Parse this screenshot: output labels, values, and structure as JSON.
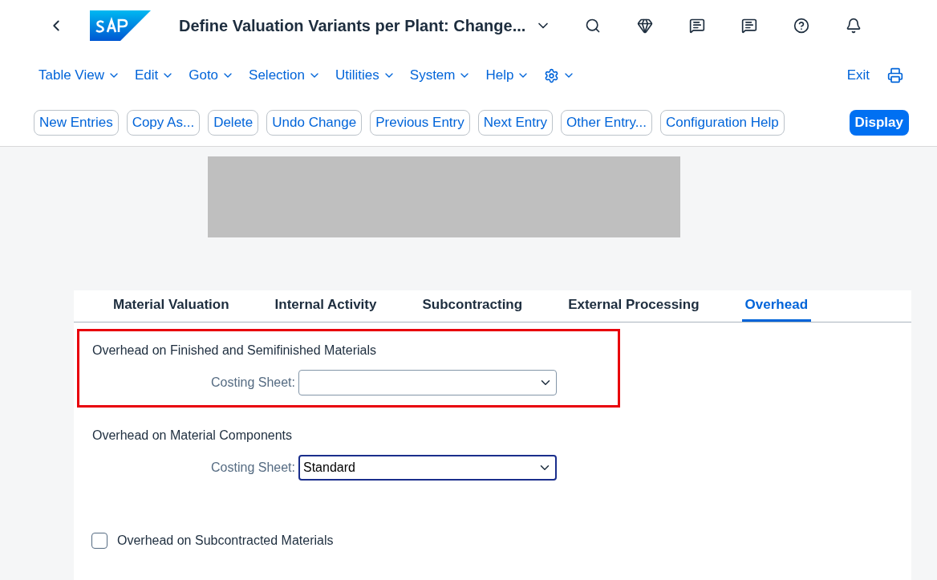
{
  "header": {
    "title": "Define Valuation Variants per Plant: Change..."
  },
  "menus": [
    {
      "label": "Table View"
    },
    {
      "label": "Edit"
    },
    {
      "label": "Goto"
    },
    {
      "label": "Selection"
    },
    {
      "label": "Utilities"
    },
    {
      "label": "System"
    },
    {
      "label": "Help"
    }
  ],
  "exit_label": "Exit",
  "toolbar_buttons": [
    {
      "label": "New Entries",
      "kind": "outline"
    },
    {
      "label": "Copy As...",
      "kind": "outline"
    },
    {
      "label": "Delete",
      "kind": "outline"
    },
    {
      "label": "Undo Change",
      "kind": "outline"
    },
    {
      "label": "Previous Entry",
      "kind": "outline"
    },
    {
      "label": "Next Entry",
      "kind": "outline"
    },
    {
      "label": "Other Entry...",
      "kind": "outline"
    },
    {
      "label": "Configuration Help",
      "kind": "outline"
    },
    {
      "label": "Display",
      "kind": "primary"
    }
  ],
  "tabs": [
    {
      "label": "Material Valuation",
      "selected": false
    },
    {
      "label": "Internal Activity",
      "selected": false
    },
    {
      "label": "Subcontracting",
      "selected": false
    },
    {
      "label": "External Processing",
      "selected": false
    },
    {
      "label": "Overhead",
      "selected": true
    }
  ],
  "sections": [
    {
      "kind": "dropdown",
      "heading": "Overhead on Finished and Semifinished Materials",
      "label": "Costing Sheet:",
      "focused": false,
      "highlighted": true
    },
    {
      "kind": "dropdown",
      "heading": "Overhead on Material Components",
      "label": "Costing Sheet:",
      "value": "Standard",
      "focused": true,
      "highlighted": false
    },
    {
      "kind": "checkbox",
      "label": "Overhead on Subcontracted Materials",
      "checked": false
    }
  ]
}
